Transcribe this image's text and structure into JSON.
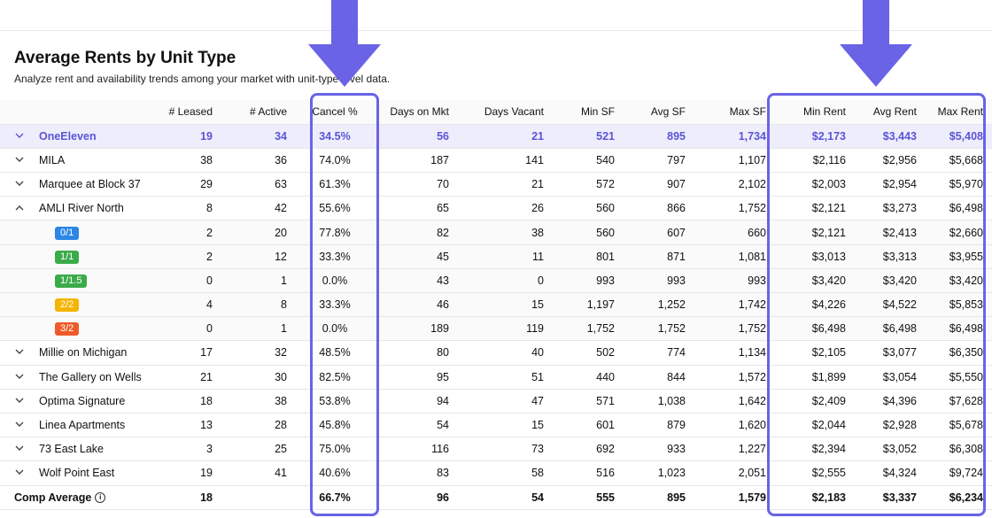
{
  "header": {
    "title": "Average Rents by Unit Type",
    "subtitle": "Analyze rent and availability trends among your market with unit-type level data."
  },
  "columns": [
    "# Leased",
    "# Active",
    "Cancel %",
    "Days on Mkt",
    "Days Vacant",
    "Min SF",
    "Avg SF",
    "Max SF",
    "Min Rent",
    "Avg Rent",
    "Max Rent"
  ],
  "rows": [
    {
      "name": "OneEleven",
      "leased": "19",
      "active": "34",
      "cancel": "34.5%",
      "dom": "56",
      "vacant": "21",
      "minsf": "521",
      "avgsf": "895",
      "maxsf": "1,734",
      "minrent": "$2,173",
      "avgrent": "$3,443",
      "maxrent": "$5,408"
    },
    {
      "name": "MILA",
      "leased": "38",
      "active": "36",
      "cancel": "74.0%",
      "dom": "187",
      "vacant": "141",
      "minsf": "540",
      "avgsf": "797",
      "maxsf": "1,107",
      "minrent": "$2,116",
      "avgrent": "$2,956",
      "maxrent": "$5,668"
    },
    {
      "name": "Marquee at Block 37",
      "leased": "29",
      "active": "63",
      "cancel": "61.3%",
      "dom": "70",
      "vacant": "21",
      "minsf": "572",
      "avgsf": "907",
      "maxsf": "2,102",
      "minrent": "$2,003",
      "avgrent": "$2,954",
      "maxrent": "$5,970"
    },
    {
      "name": "AMLI River North",
      "leased": "8",
      "active": "42",
      "cancel": "55.6%",
      "dom": "65",
      "vacant": "26",
      "minsf": "560",
      "avgsf": "866",
      "maxsf": "1,752",
      "minrent": "$2,121",
      "avgrent": "$3,273",
      "maxrent": "$6,498"
    },
    {
      "name": "0/1",
      "leased": "2",
      "active": "20",
      "cancel": "77.8%",
      "dom": "82",
      "vacant": "38",
      "minsf": "560",
      "avgsf": "607",
      "maxsf": "660",
      "minrent": "$2,121",
      "avgrent": "$2,413",
      "maxrent": "$2,660"
    },
    {
      "name": "1/1",
      "leased": "2",
      "active": "12",
      "cancel": "33.3%",
      "dom": "45",
      "vacant": "11",
      "minsf": "801",
      "avgsf": "871",
      "maxsf": "1,081",
      "minrent": "$3,013",
      "avgrent": "$3,313",
      "maxrent": "$3,955"
    },
    {
      "name": "1/1.5",
      "leased": "0",
      "active": "1",
      "cancel": "0.0%",
      "dom": "43",
      "vacant": "0",
      "minsf": "993",
      "avgsf": "993",
      "maxsf": "993",
      "minrent": "$3,420",
      "avgrent": "$3,420",
      "maxrent": "$3,420"
    },
    {
      "name": "2/2",
      "leased": "4",
      "active": "8",
      "cancel": "33.3%",
      "dom": "46",
      "vacant": "15",
      "minsf": "1,197",
      "avgsf": "1,252",
      "maxsf": "1,742",
      "minrent": "$4,226",
      "avgrent": "$4,522",
      "maxrent": "$5,853"
    },
    {
      "name": "3/2",
      "leased": "0",
      "active": "1",
      "cancel": "0.0%",
      "dom": "189",
      "vacant": "119",
      "minsf": "1,752",
      "avgsf": "1,752",
      "maxsf": "1,752",
      "minrent": "$6,498",
      "avgrent": "$6,498",
      "maxrent": "$6,498"
    },
    {
      "name": "Millie on Michigan",
      "leased": "17",
      "active": "32",
      "cancel": "48.5%",
      "dom": "80",
      "vacant": "40",
      "minsf": "502",
      "avgsf": "774",
      "maxsf": "1,134",
      "minrent": "$2,105",
      "avgrent": "$3,077",
      "maxrent": "$6,350"
    },
    {
      "name": "The Gallery on Wells",
      "leased": "21",
      "active": "30",
      "cancel": "82.5%",
      "dom": "95",
      "vacant": "51",
      "minsf": "440",
      "avgsf": "844",
      "maxsf": "1,572",
      "minrent": "$1,899",
      "avgrent": "$3,054",
      "maxrent": "$5,550"
    },
    {
      "name": "Optima Signature",
      "leased": "18",
      "active": "38",
      "cancel": "53.8%",
      "dom": "94",
      "vacant": "47",
      "minsf": "571",
      "avgsf": "1,038",
      "maxsf": "1,642",
      "minrent": "$2,409",
      "avgrent": "$4,396",
      "maxrent": "$7,628"
    },
    {
      "name": "Linea Apartments",
      "leased": "13",
      "active": "28",
      "cancel": "45.8%",
      "dom": "54",
      "vacant": "15",
      "minsf": "601",
      "avgsf": "879",
      "maxsf": "1,620",
      "minrent": "$2,044",
      "avgrent": "$2,928",
      "maxrent": "$5,678"
    },
    {
      "name": "73 East Lake",
      "leased": "3",
      "active": "25",
      "cancel": "75.0%",
      "dom": "116",
      "vacant": "73",
      "minsf": "692",
      "avgsf": "933",
      "maxsf": "1,227",
      "minrent": "$2,394",
      "avgrent": "$3,052",
      "maxrent": "$6,308"
    },
    {
      "name": "Wolf Point East",
      "leased": "19",
      "active": "41",
      "cancel": "40.6%",
      "dom": "83",
      "vacant": "58",
      "minsf": "516",
      "avgsf": "1,023",
      "maxsf": "2,051",
      "minrent": "$2,555",
      "avgrent": "$4,324",
      "maxrent": "$9,724"
    }
  ],
  "footer": {
    "name": "Comp Average",
    "leased": "18",
    "active": "",
    "cancel": "66.7%",
    "dom": "96",
    "vacant": "54",
    "minsf": "555",
    "avgsf": "895",
    "maxsf": "1,579",
    "minrent": "$2,183",
    "avgrent": "$3,337",
    "maxrent": "$6,234"
  },
  "icons": {
    "expand": "chevron-down-icon",
    "collapse": "chevron-up-icon",
    "info": "info-icon",
    "arrow": "arrow-down-icon"
  },
  "colors": {
    "accent": "#6a63e6",
    "highlight_bg": "#eeedfb",
    "highlight_text": "#5a55d6",
    "badge_0_1": "#2d86e6",
    "badge_1_1": "#3bab4a",
    "badge_1_1_5": "#3bab4a",
    "badge_2_2": "#f4b400",
    "badge_3_2": "#ef5a2a"
  }
}
